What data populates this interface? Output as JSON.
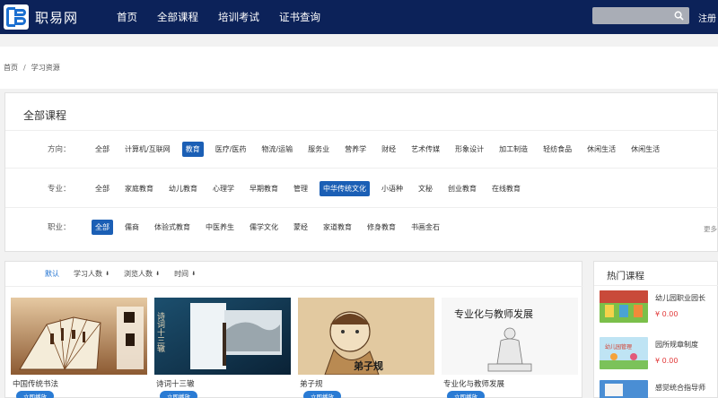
{
  "header": {
    "site_name": "职易网",
    "nav": [
      "首页",
      "全部课程",
      "培训考试",
      "证书查询"
    ],
    "search_placeholder": "",
    "login_label": "注册"
  },
  "breadcrumb": {
    "home": "首页",
    "separator": "/",
    "current": "学习资源"
  },
  "filter": {
    "title": "全部课程",
    "rows": [
      {
        "label": "方向：",
        "tags": [
          "全部",
          "计算机/互联网",
          "教育",
          "医疗/医药",
          "物流/运输",
          "服务业",
          "营养学",
          "财经",
          "艺术传媒",
          "形象设计",
          "加工制造",
          "轻纺食品",
          "休闲生活",
          "休闲生活"
        ],
        "active_index": 2
      },
      {
        "label": "专业：",
        "tags": [
          "全部",
          "家庭教育",
          "幼儿教育",
          "心理学",
          "早期教育",
          "管理",
          "中华传统文化",
          "小语种",
          "文秘",
          "创业教育",
          "在线教育"
        ],
        "active_index": 6
      },
      {
        "label": "职业：",
        "tags": [
          "全部",
          "儒商",
          "体验式教育",
          "中医养生",
          "儒学文化",
          "蒙经",
          "家道教育",
          "修身教育",
          "书画金石"
        ],
        "active_index": 0
      }
    ],
    "more_label": "更多"
  },
  "sort": {
    "items": [
      {
        "label": "默认",
        "arrow": ""
      },
      {
        "label": "学习人数",
        "arrow": "⬇"
      },
      {
        "label": "浏览人数",
        "arrow": "⬇"
      },
      {
        "label": "时间",
        "arrow": "⬇"
      }
    ]
  },
  "courses": [
    {
      "title": "中国传统书法",
      "button": "立即播放"
    },
    {
      "title": "诗词十三辙",
      "button": "立即播放",
      "image_text": "诗词十三辙"
    },
    {
      "title": "弟子规",
      "button": "立即播放",
      "image_text": "弟子规"
    },
    {
      "title": "专业化与教师发展",
      "button": "立即播放",
      "image_text": "专业化与教师发展"
    }
  ],
  "hot": {
    "title": "热门课程",
    "items": [
      {
        "name": "幼儿园职业园长",
        "price": "¥ 0.00"
      },
      {
        "name": "园所规章制度",
        "price": "¥ 0.00",
        "image_text": "幼儿园管理"
      },
      {
        "name": "感觉统合指导师",
        "price": ""
      }
    ]
  },
  "colors": {
    "header_bg": "#0c2259",
    "accent": "#1b5fb5",
    "price": "#e23b3b"
  }
}
